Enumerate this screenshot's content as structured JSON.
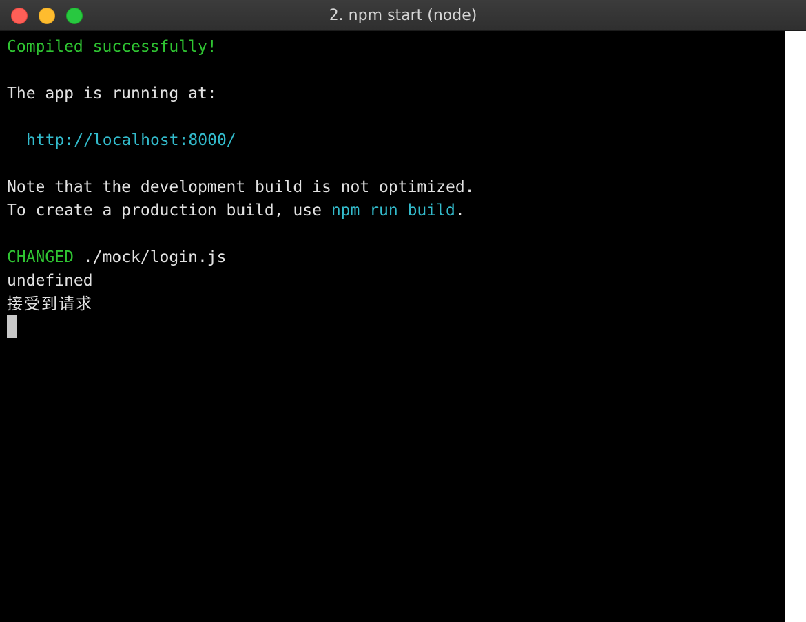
{
  "window": {
    "title": "2. npm start (node)"
  },
  "terminal": {
    "line1": "Compiled successfully!",
    "line2": "The app is running at:",
    "url": "http://localhost:8000/",
    "line4": "Note that the development build is not optimized.",
    "line5_prefix": "To create a production build, use ",
    "line5_command": "npm run build",
    "line5_suffix": ".",
    "changed_label": "CHANGED",
    "changed_path": " ./mock/login.js",
    "line7": "undefined",
    "line8": "接受到请求"
  },
  "colors": {
    "success": "#2fc432",
    "link": "#33bccd",
    "text": "#e2e2e2",
    "background": "#000000"
  }
}
